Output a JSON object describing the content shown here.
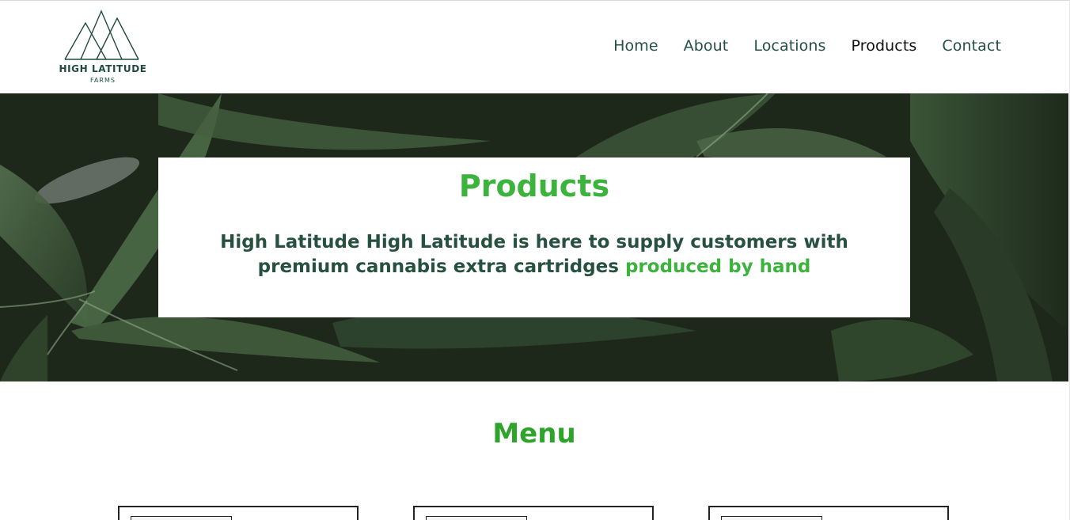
{
  "brand": {
    "name": "HIGH LATITUDE",
    "subtitle": "FARMS"
  },
  "nav": {
    "items": [
      {
        "label": "Home",
        "active": false
      },
      {
        "label": "About",
        "active": false
      },
      {
        "label": "Locations",
        "active": false
      },
      {
        "label": "Products",
        "active": true
      },
      {
        "label": "Contact",
        "active": false
      }
    ]
  },
  "hero": {
    "title": "Products",
    "text_main": "High Latitude High Latitude is here to supply customers with premium cannabis extra cartridges ",
    "text_accent": "produced by hand"
  },
  "menu": {
    "title": "Menu"
  },
  "colors": {
    "brand_dark": "#244f46",
    "accent_green": "#3cb33c",
    "menu_green": "#2fa42b"
  }
}
